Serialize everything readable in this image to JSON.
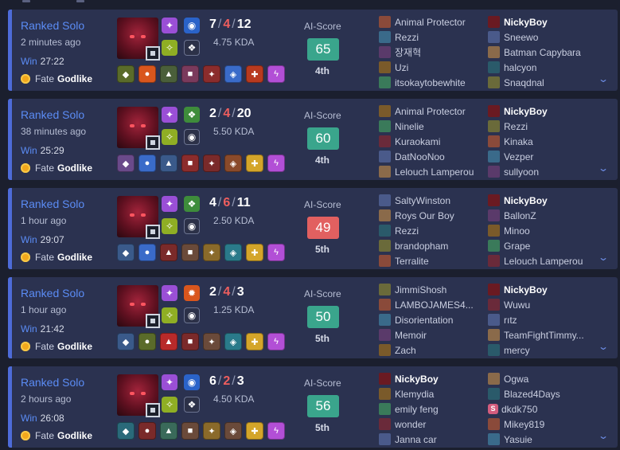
{
  "colors": {
    "win_accent": "#4d6bd8",
    "score_good": "#3aa58c",
    "score_bad": "#e26060",
    "card_bg": "#2b3250",
    "page_bg": "#1b1f2e"
  },
  "matches": [
    {
      "queue": "Ranked Solo",
      "time_ago": "2 minutes ago",
      "result": "Win",
      "duration": "27:22",
      "rank_prefix": "Fate",
      "rank_name": "Godlike",
      "kills": "7",
      "deaths": "4",
      "assists": "12",
      "sep": "/",
      "kda_ratio": "4.75 KDA",
      "ai_label": "AI-Score",
      "ai_score": "65",
      "ai_good": true,
      "placement": "4th",
      "spells": [
        "flash-icon",
        "smite-icon"
      ],
      "runes": [
        "blue-rune-icon",
        "green-rune-icon"
      ],
      "items": [
        "#5a6b2a",
        "#d9561d",
        "#4a5f3a",
        "#7a3a5c",
        "#8b2c2c",
        "#3a6bc9",
        "#b83a1f",
        "#b24fd6"
      ],
      "team_a": [
        "Animal Protector",
        "Rezzi",
        "장재혁",
        "Uzi",
        "itsokaytobewhite"
      ],
      "team_b": [
        "NickyBoy",
        "Sneewo",
        "Batman Capybara",
        "halcyon",
        "Snaqdnal"
      ],
      "me_team": "b",
      "me_index": 0,
      "tag_index": -1
    },
    {
      "queue": "Ranked Solo",
      "time_ago": "38 minutes ago",
      "result": "Win",
      "duration": "25:29",
      "rank_prefix": "Fate",
      "rank_name": "Godlike",
      "kills": "2",
      "deaths": "4",
      "assists": "20",
      "sep": "/",
      "kda_ratio": "5.50 KDA",
      "ai_label": "AI-Score",
      "ai_score": "60",
      "ai_good": true,
      "placement": "4th",
      "spells": [
        "flash-icon",
        "smite-icon"
      ],
      "runes": [
        "green-rune-icon",
        "blue-rune-icon"
      ],
      "items": [
        "#6a4a8a",
        "#3a6bc9",
        "#3a5a8a",
        "#8b2c2c",
        "#7a2a2a",
        "#8a4a2a",
        "#d4a52a",
        "#b24fd6"
      ],
      "team_a": [
        "Animal Protector",
        "Ninelie",
        "Kuraokami",
        "DatNooNoo",
        "Lelouch Lamperou"
      ],
      "team_b": [
        "NickyBoy",
        "Rezzi",
        "Kinaka",
        "Vezper",
        "sullyoon"
      ],
      "me_team": "b",
      "me_index": 0,
      "tag_index": -1
    },
    {
      "queue": "Ranked Solo",
      "time_ago": "1 hour ago",
      "result": "Win",
      "duration": "29:07",
      "rank_prefix": "Fate",
      "rank_name": "Godlike",
      "kills": "4",
      "deaths": "6",
      "assists": "11",
      "sep": "/",
      "kda_ratio": "2.50 KDA",
      "ai_label": "AI-Score",
      "ai_score": "49",
      "ai_good": false,
      "placement": "5th",
      "spells": [
        "flash-icon",
        "smite-icon"
      ],
      "runes": [
        "green-rune-icon",
        "blue-rune-icon"
      ],
      "items": [
        "#3a5a8a",
        "#3a6bc9",
        "#7a2a2a",
        "#6a4a3a",
        "#8a6a2a",
        "#2a7a8a",
        "#d4a52a",
        "#b24fd6"
      ],
      "team_a": [
        "SaltyWinston",
        "Roys Our Boy",
        "Rezzi",
        "brandopham",
        "Terralite"
      ],
      "team_b": [
        "NickyBoy",
        "BallonZ",
        "Minoo",
        "Grape",
        "Lelouch Lamperou"
      ],
      "me_team": "b",
      "me_index": 0,
      "tag_index": -1
    },
    {
      "queue": "Ranked Solo",
      "time_ago": "1 hour ago",
      "result": "Win",
      "duration": "21:42",
      "rank_prefix": "Fate",
      "rank_name": "Godlike",
      "kills": "2",
      "deaths": "4",
      "assists": "3",
      "sep": "/",
      "kda_ratio": "1.25 KDA",
      "ai_label": "AI-Score",
      "ai_score": "50",
      "ai_good": true,
      "placement": "5th",
      "spells": [
        "flash-icon",
        "smite-icon"
      ],
      "runes": [
        "orange-rune-icon",
        "blue-rune-icon"
      ],
      "items": [
        "#3a5a8a",
        "#5a6b2a",
        "#b82a2a",
        "#7a2a2a",
        "#6a4a3a",
        "#2a7a8a",
        "#d4a52a",
        "#b24fd6"
      ],
      "team_a": [
        "JimmiShosh",
        "LAMBOJAMES4...",
        "Disorientation",
        "Memoir",
        "Zach"
      ],
      "team_b": [
        "NickyBoy",
        "Wuwu",
        "rıtz",
        "TeamFightTimmy...",
        "mercy"
      ],
      "me_team": "b",
      "me_index": 0,
      "tag_index": -1
    },
    {
      "queue": "Ranked Solo",
      "time_ago": "2 hours ago",
      "result": "Win",
      "duration": "26:08",
      "rank_prefix": "Fate",
      "rank_name": "Godlike",
      "kills": "6",
      "deaths": "2",
      "assists": "3",
      "sep": "/",
      "kda_ratio": "4.50 KDA",
      "ai_label": "AI-Score",
      "ai_score": "56",
      "ai_good": true,
      "placement": "5th",
      "spells": [
        "flash-icon",
        "smite-icon"
      ],
      "runes": [
        "blue-rune-icon",
        "green-rune-icon"
      ],
      "items": [
        "#2a6a7a",
        "#7a2a2a",
        "#3a6a5a",
        "#6a4a3a",
        "#8a6a2a",
        "#6a4a3a",
        "#d4a52a",
        "#b24fd6"
      ],
      "team_a": [
        "NickyBoy",
        "Klemydia",
        "emily feng",
        "wonder",
        "Janna car"
      ],
      "team_b": [
        "Ogwa",
        "Blazed4Days",
        "dkdk750",
        "Mikey819",
        "Yasuie"
      ],
      "me_team": "a",
      "me_index": 0,
      "tag_index": 2,
      "tag_letter": "S"
    }
  ],
  "player_icon_colors": [
    "#8a4a3a",
    "#3a6a8a",
    "#5a3a6a",
    "#7a5a2a",
    "#3a7a5a",
    "#6a2a3a",
    "#4a5a8a",
    "#8a6a4a",
    "#2a5a6a",
    "#6a6a3a"
  ]
}
